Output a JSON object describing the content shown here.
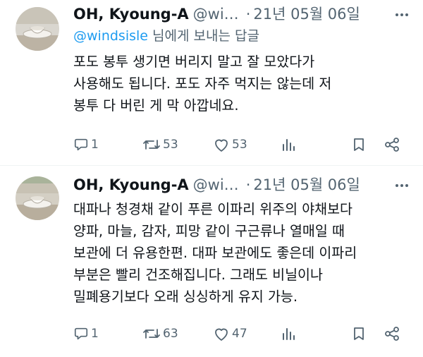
{
  "tweets": [
    {
      "name": "OH, Kyoung-A",
      "handle": "@wi…",
      "separator": "·",
      "time": "21년 05월 06일",
      "reply_to": {
        "mention": "@windsisle",
        "suffix": " 님에게 보내는 답글"
      },
      "lines": [
        "포도 봉투 생기면 버리지 말고 잘 모았다가",
        "사용해도 됩니다. 포도 자주 먹지는 않는데 저",
        "봉투 다 버린 게 막 아깝네요."
      ],
      "replies": "1",
      "retweets": "53",
      "likes": "53"
    },
    {
      "name": "OH, Kyoung-A",
      "handle": "@wi…",
      "separator": "·",
      "time": "21년 05월 06일",
      "lines": [
        "대파나 청경채 같이 푸른 이파리 위주의 야채보다",
        "양파, 마늘, 감자, 피망 같이 구근류나 열매일 때",
        "보관에 더 유용한편. 대파 보관에도 좋은데 이파리",
        "부분은 빨리 건조해집니다. 그래도 비닐이나",
        "밀폐용기보다 오래 싱싱하게 유지 가능."
      ],
      "replies": "1",
      "retweets": "63",
      "likes": "47"
    }
  ],
  "colors": {
    "text": "#0f1419",
    "secondary": "#536471",
    "link": "#1d9bf0"
  },
  "icons": [
    "reply-icon",
    "retweet-icon",
    "like-icon",
    "views-icon",
    "bookmark-icon",
    "share-icon",
    "more-icon"
  ]
}
